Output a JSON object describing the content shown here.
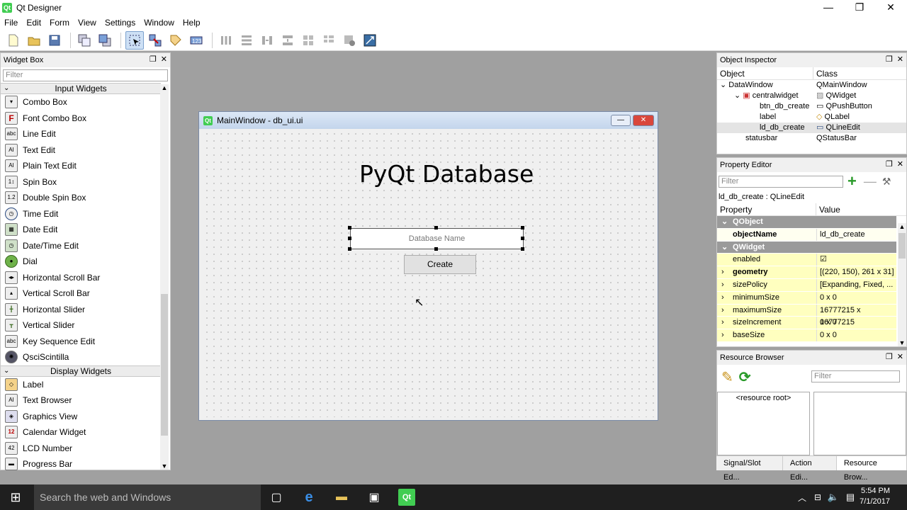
{
  "window": {
    "title": "Qt Designer",
    "logo": "Qt"
  },
  "menu": [
    "File",
    "Edit",
    "Form",
    "View",
    "Settings",
    "Window",
    "Help"
  ],
  "widget_box": {
    "title": "Widget Box",
    "filter_placeholder": "Filter",
    "categories": [
      {
        "name": "Input Widgets",
        "items": [
          "Combo Box",
          "Font Combo Box",
          "Line Edit",
          "Text Edit",
          "Plain Text Edit",
          "Spin Box",
          "Double Spin Box",
          "Time Edit",
          "Date Edit",
          "Date/Time Edit",
          "Dial",
          "Horizontal Scroll Bar",
          "Vertical Scroll Bar",
          "Horizontal Slider",
          "Vertical Slider",
          "Key Sequence Edit",
          "QsciScintilla"
        ]
      },
      {
        "name": "Display Widgets",
        "items": [
          "Label",
          "Text Browser",
          "Graphics View",
          "Calendar Widget",
          "LCD Number",
          "Progress Bar"
        ]
      }
    ]
  },
  "form": {
    "title": "MainWindow - db_ui.ui",
    "heading": "PyQt Database",
    "line_edit_placeholder": "Database Name",
    "button_label": "Create"
  },
  "object_inspector": {
    "title": "Object Inspector",
    "col_object": "Object",
    "col_class": "Class",
    "rows": [
      {
        "object": "DataWindow",
        "class": "QMainWindow"
      },
      {
        "object": "centralwidget",
        "class": "QWidget"
      },
      {
        "object": "btn_db_create",
        "class": "QPushButton"
      },
      {
        "object": "label",
        "class": "QLabel"
      },
      {
        "object": "ld_db_create",
        "class": "QLineEdit"
      },
      {
        "object": "statusbar",
        "class": "QStatusBar"
      }
    ]
  },
  "property_editor": {
    "title": "Property Editor",
    "filter_placeholder": "Filter",
    "context": "ld_db_create : QLineEdit",
    "col_property": "Property",
    "col_value": "Value",
    "rows": [
      {
        "name": "QObject",
        "value": "",
        "kind": "grp"
      },
      {
        "name": "objectName",
        "value": "ld_db_create",
        "kind": "wht",
        "bold": true
      },
      {
        "name": "QWidget",
        "value": "",
        "kind": "grp"
      },
      {
        "name": "enabled",
        "value": "☑",
        "kind": "yel"
      },
      {
        "name": "geometry",
        "value": "[(220, 150), 261 x 31]",
        "kind": "yel",
        "bold": true
      },
      {
        "name": "sizePolicy",
        "value": "[Expanding, Fixed, ...",
        "kind": "yel"
      },
      {
        "name": "minimumSize",
        "value": "0 x 0",
        "kind": "yel"
      },
      {
        "name": "maximumSize",
        "value": "16777215 x 16777215",
        "kind": "yel"
      },
      {
        "name": "sizeIncrement",
        "value": "0 x 0",
        "kind": "yel"
      },
      {
        "name": "baseSize",
        "value": "0 x 0",
        "kind": "yel"
      }
    ]
  },
  "resource_browser": {
    "title": "Resource Browser",
    "filter_placeholder": "Filter",
    "root": "<resource root>"
  },
  "bottom_tabs": [
    "Signal/Slot Ed...",
    "Action Edi...",
    "Resource Brow..."
  ],
  "taskbar": {
    "search_placeholder": "Search the web and Windows",
    "time": "5:54 PM",
    "date": "7/1/2017"
  }
}
